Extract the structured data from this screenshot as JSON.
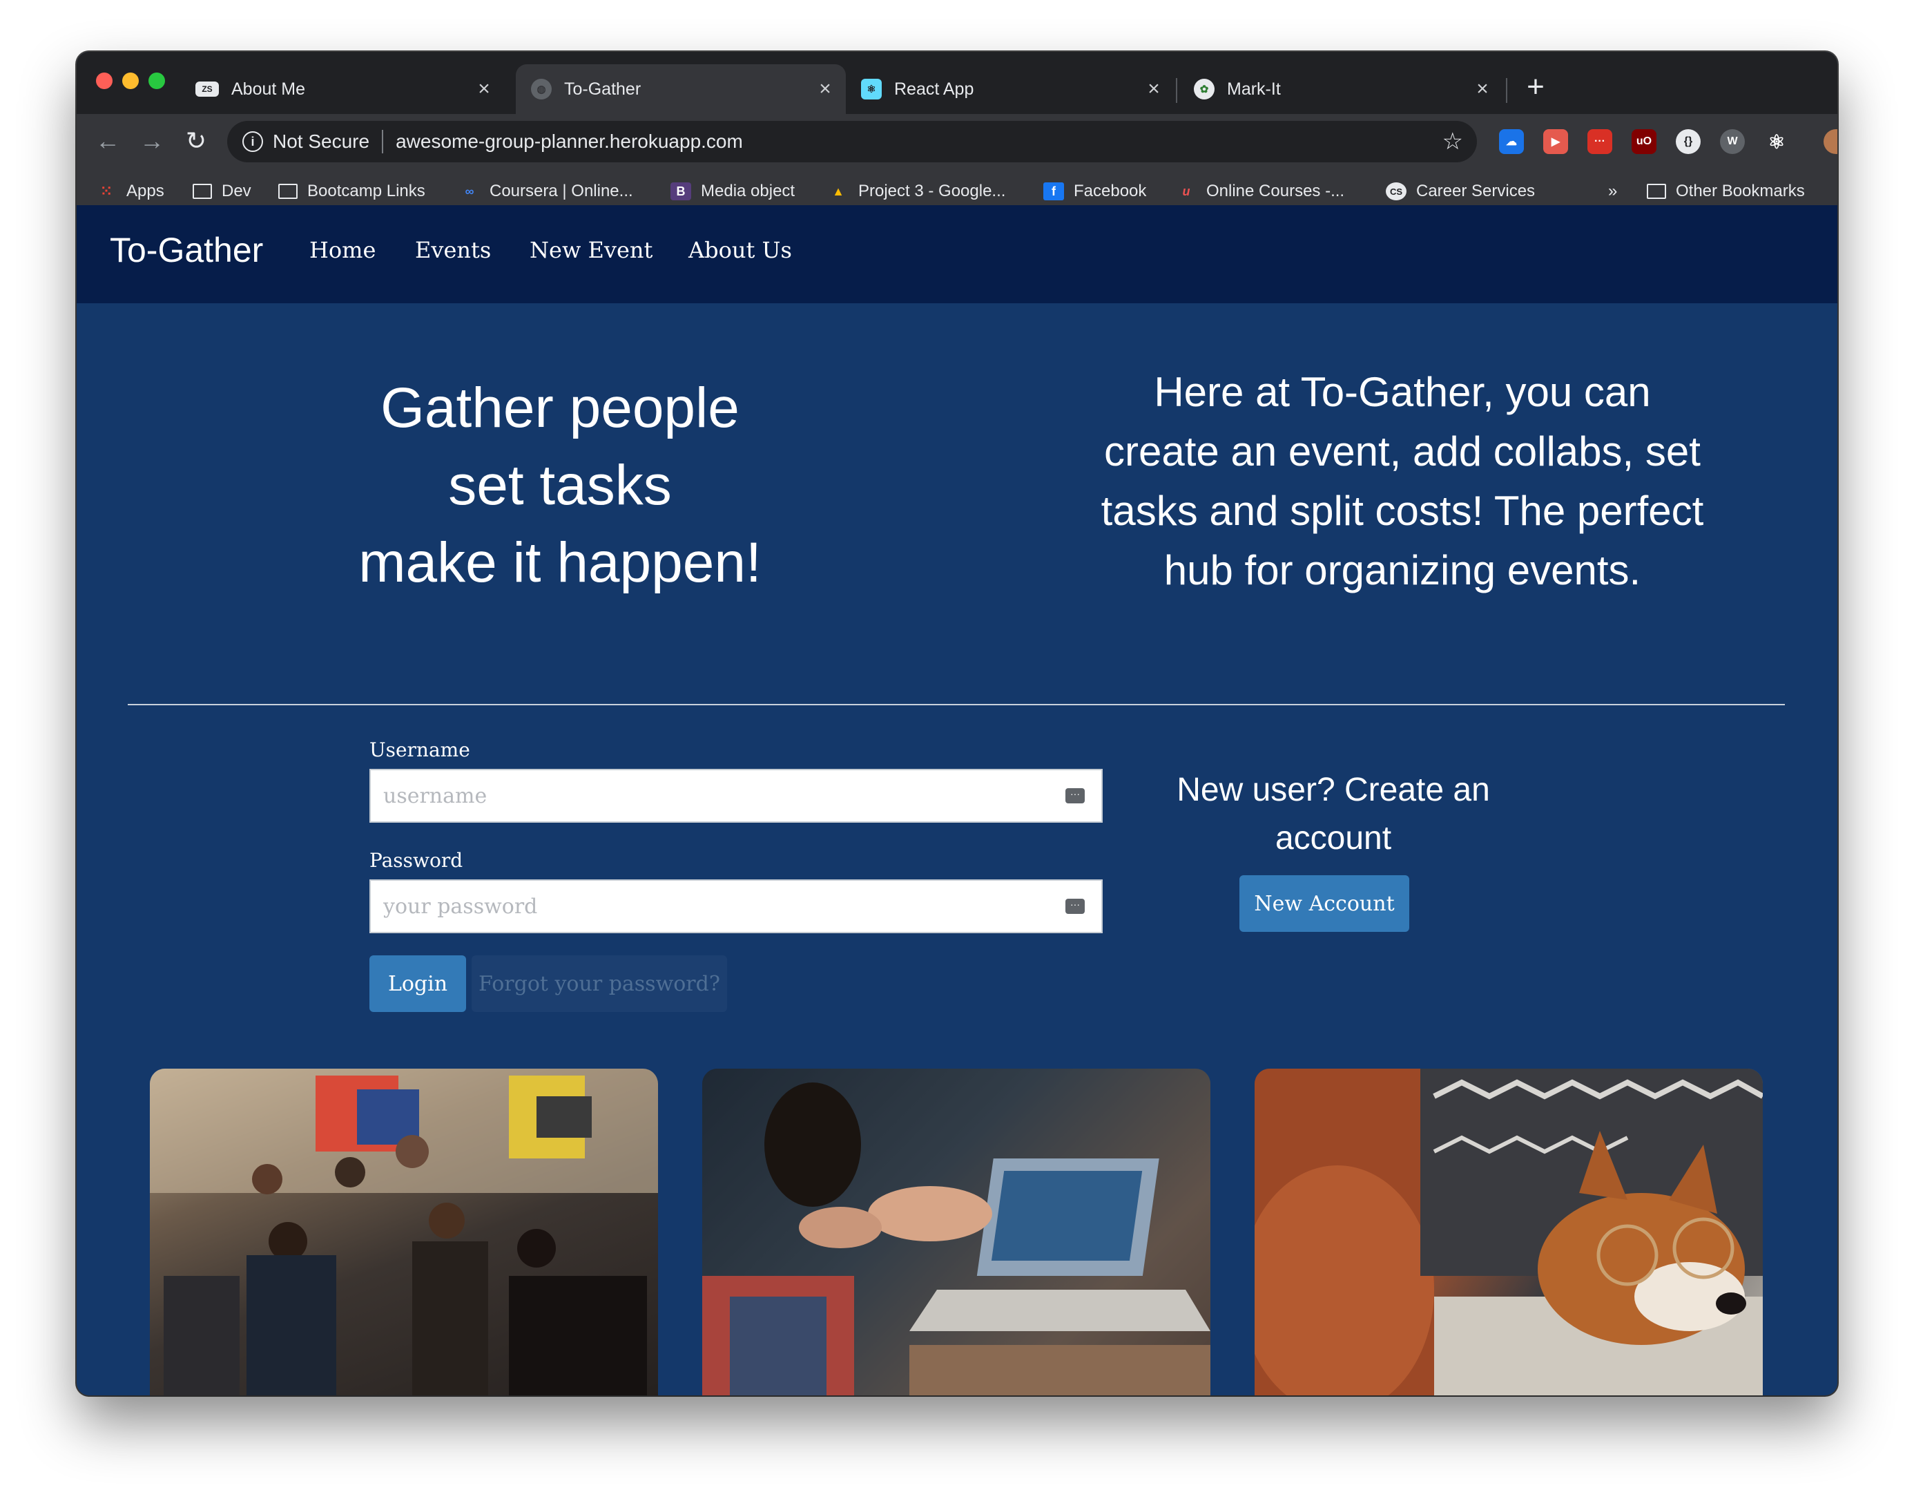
{
  "browser": {
    "tabs": [
      {
        "title": "About Me",
        "favicon": "ZS"
      },
      {
        "title": "To-Gather",
        "favicon": "globe"
      },
      {
        "title": "React App",
        "favicon": "react"
      },
      {
        "title": "Mark-It",
        "favicon": "mark"
      }
    ],
    "url_security": "Not Secure",
    "url": "awesome-group-planner.herokuapp.com",
    "bookmarks": [
      "Apps",
      "Dev",
      "Bootcamp Links",
      "Coursera | Online...",
      "Media object",
      "Project 3 - Google...",
      "Facebook",
      "Online Courses -...",
      "Career Services"
    ],
    "bookmarks_overflow": "»",
    "other_bookmarks": "Other Bookmarks"
  },
  "site": {
    "brand": "To-Gather",
    "nav": [
      "Home",
      "Events",
      "New Event",
      "About Us"
    ],
    "hero_left": [
      "Gather people",
      "set tasks",
      "make it happen!"
    ],
    "hero_right": "Here at To-Gather, you can create an event, add collabs, set tasks and split costs! The perfect hub for organizing events.",
    "form": {
      "username_label": "Username",
      "username_placeholder": "username",
      "password_label": "Password",
      "password_placeholder": "your password",
      "login": "Login",
      "forgot": "Forgot your password?"
    },
    "new_user_text": "New user? Create an account",
    "new_account": "New Account"
  },
  "colors": {
    "navbar": "#061d4a",
    "page_bg": "#14386a",
    "button": "#337ab7"
  }
}
